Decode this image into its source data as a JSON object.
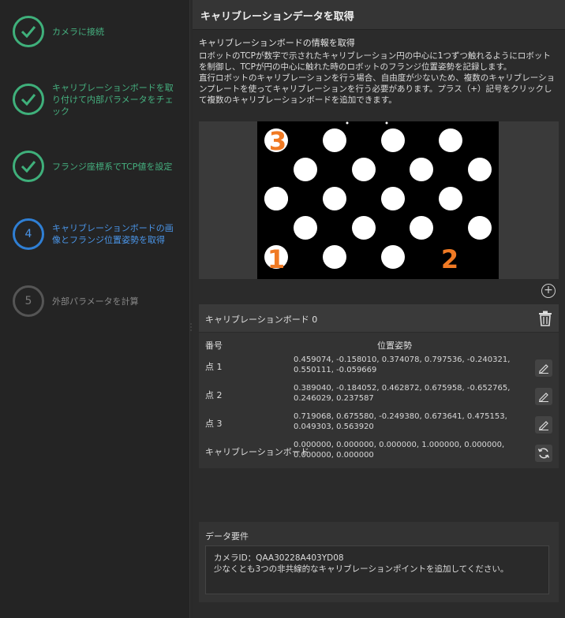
{
  "sidebar": {
    "steps": [
      {
        "label": "カメラに接続",
        "state": "done"
      },
      {
        "label": "キャリブレーションボードを取り付けて内部パラメータをチェック",
        "state": "done"
      },
      {
        "label": "フランジ座標系でTCP値を設定",
        "state": "done"
      },
      {
        "number": "4",
        "label": "キャリブレーションボードの画像とフランジ位置姿勢を取得",
        "state": "active"
      },
      {
        "number": "5",
        "label": "外部パラメータを計算",
        "state": "todo"
      }
    ]
  },
  "panel": {
    "title": "キャリブレーションデータを取得",
    "info": {
      "title": "キャリブレーションボードの情報を取得",
      "line1": "ロボットのTCPが数字で示されたキャリブレーション円の中心に1つずつ触れるようにロボットを制御し、TCPが円の中心に触れた時のロボットのフランジ位置姿勢を記録します。",
      "line2": "直行ロボットのキャリブレーションを行う場合、自由度が少ないため、複数のキャリブレーションプレートを使ってキャリブレーションを行う必要があります。プラス（+）記号をクリックして複数のキャリブレーションボードを追加できます。"
    },
    "board_image": {
      "markers": [
        "1",
        "2",
        "3"
      ],
      "marker_color": "#f07a24"
    },
    "board": {
      "title": "キャリブレーションボード 0",
      "col_number": "番号",
      "col_pose": "位置姿勢",
      "rows": [
        {
          "label": "点 1",
          "value": "0.459074, -0.158010, 0.374078, 0.797536, -0.240321, 0.550111, -0.059669",
          "action": "edit-icon"
        },
        {
          "label": "点 2",
          "value": "0.389040, -0.184052, 0.462872, 0.675958, -0.652765, 0.246029, 0.237587",
          "action": "edit-icon"
        },
        {
          "label": "点 3",
          "value": "0.719068, 0.675580, -0.249380, 0.673641, 0.475153, 0.049303, 0.563920",
          "action": "edit-icon"
        },
        {
          "label": "キャリブレーションボード",
          "value": "0.000000, 0.000000, 0.000000, 1.000000, 0.000000, 0.000000, 0.000000",
          "action": "refresh-icon"
        }
      ]
    },
    "requirements": {
      "title": "データ要件",
      "camera_id": "カメラID：QAA30228A403YD08",
      "note": "少なくとも3つの非共線的なキャリブレーションポイントを追加してください。"
    }
  },
  "colors": {
    "done": "#3fb07b",
    "active": "#2f7fd4",
    "accent_orange": "#f07a24"
  }
}
